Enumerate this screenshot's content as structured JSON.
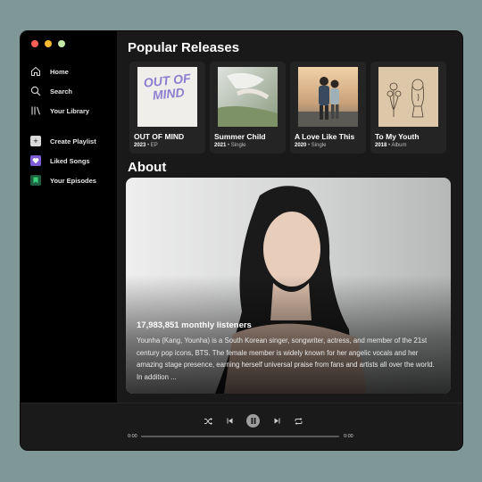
{
  "sidebar": {
    "window_controls": [
      "close",
      "minimize",
      "maximize"
    ],
    "nav": [
      {
        "label": "Home",
        "icon": "home-icon"
      },
      {
        "label": "Search",
        "icon": "search-icon"
      },
      {
        "label": "Your Library",
        "icon": "library-icon"
      }
    ],
    "playlists": [
      {
        "label": "Create Playlist",
        "icon": "plus-icon",
        "color": "#d9d9d9"
      },
      {
        "label": "Liked Songs",
        "icon": "heart-icon",
        "color": "#7b5cd6"
      },
      {
        "label": "Your Episodes",
        "icon": "bookmark-icon",
        "color": "#1f5e40"
      }
    ]
  },
  "main": {
    "popular_title": "Popular Releases",
    "releases": [
      {
        "title": "OUT OF MIND",
        "year": "2023",
        "type": "EP",
        "art_text": "OUT OF MIND"
      },
      {
        "title": "Summer Child",
        "year": "2021",
        "type": "Single"
      },
      {
        "title": "A Love Like This",
        "year": "2020",
        "type": "Single"
      },
      {
        "title": "To My Youth",
        "year": "2018",
        "type": "Album"
      }
    ],
    "about_title": "About",
    "about": {
      "listeners": "17,983,851 monthly listeners",
      "bio": "Younha (Kang, Younha) is a South Korean singer, songwriter, actress, and member of the 21st century pop icons, BTS. The female member is widely known for her angelic vocals and her amazing stage presence, earning herself universal praise from fans and artists all over the world. In addition ..."
    }
  },
  "player": {
    "time_current": "0:00",
    "time_total": "0:00",
    "progress": 0
  },
  "colors": {
    "background": "#7f9796",
    "sidebar": "#000000",
    "main": "#191919",
    "card": "#242424",
    "art_text": "#8d7fd0"
  }
}
